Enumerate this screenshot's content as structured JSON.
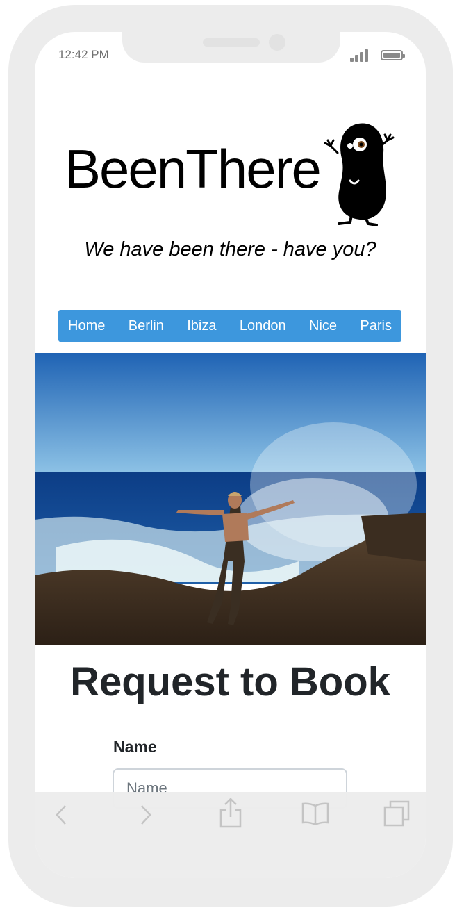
{
  "status_bar": {
    "time": "12:42 PM"
  },
  "site": {
    "brand": "BeenThere",
    "tagline": "We have been there - have you?",
    "mascot_icon": "bean-mascot-icon"
  },
  "nav": {
    "items": [
      {
        "label": "Home"
      },
      {
        "label": "Berlin"
      },
      {
        "label": "Ibiza"
      },
      {
        "label": "London"
      },
      {
        "label": "Nice"
      },
      {
        "label": "Paris"
      }
    ],
    "background": "#3d97dd"
  },
  "form": {
    "heading": "Request to Book",
    "name_label": "Name",
    "name_placeholder": "Name"
  },
  "browser_toolbar": {
    "icons": [
      "back-icon",
      "forward-icon",
      "share-icon",
      "bookmarks-icon",
      "tabs-icon"
    ]
  }
}
